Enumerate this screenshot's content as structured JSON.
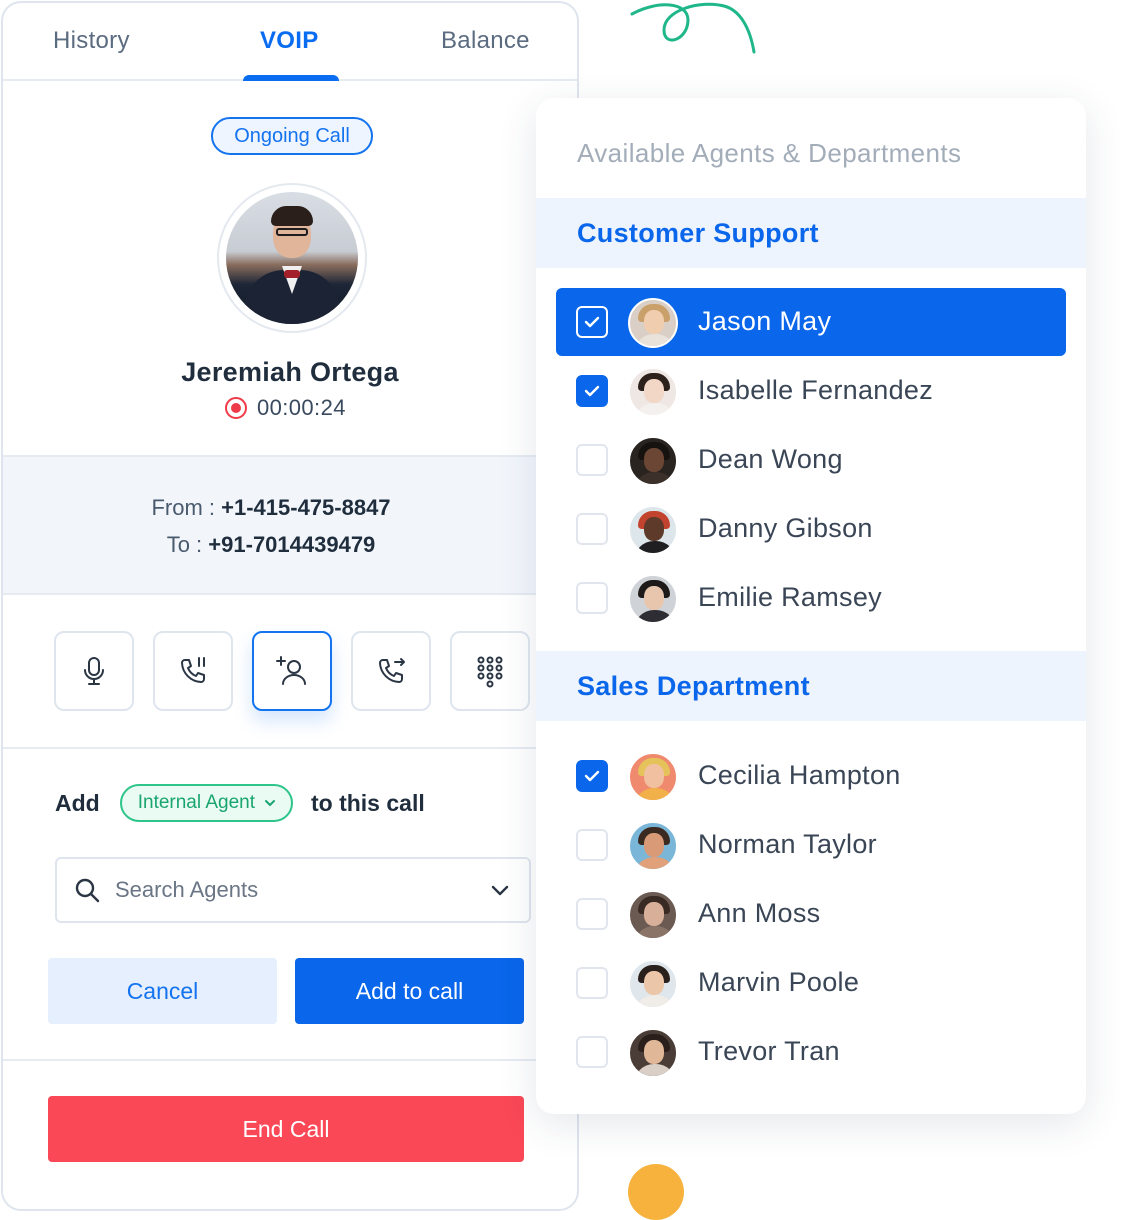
{
  "tabs": [
    {
      "label": "History"
    },
    {
      "label": "VOIP"
    },
    {
      "label": "Balance"
    }
  ],
  "call": {
    "status": "Ongoing Call",
    "caller_name": "Jeremiah Ortega",
    "duration": "00:00:24",
    "from_label": "From :",
    "from_number": "+1-415-475-8847",
    "to_label": "To :",
    "to_number": "+91-7014439479"
  },
  "controls": [
    {
      "icon": "microphone-icon"
    },
    {
      "icon": "call-hold-icon"
    },
    {
      "icon": "add-agent-icon",
      "active": true
    },
    {
      "icon": "call-forward-icon"
    },
    {
      "icon": "dialpad-icon"
    }
  ],
  "add_section": {
    "prefix": "Add",
    "agent_type": "Internal Agent",
    "suffix": "to this call",
    "search_placeholder": "Search Agents"
  },
  "buttons": {
    "cancel": "Cancel",
    "add_to_call": "Add to call",
    "end_call": "End Call"
  },
  "agents_panel": {
    "title": "Available Agents & Departments",
    "departments": [
      {
        "name": "Customer Support",
        "agents": [
          {
            "name": "Jason May",
            "checked": true,
            "highlighted": true
          },
          {
            "name": "Isabelle Fernandez",
            "checked": true
          },
          {
            "name": "Dean Wong",
            "checked": false
          },
          {
            "name": "Danny Gibson",
            "checked": false
          },
          {
            "name": "Emilie Ramsey",
            "checked": false
          }
        ]
      },
      {
        "name": "Sales Department",
        "agents": [
          {
            "name": "Cecilia Hampton",
            "checked": true
          },
          {
            "name": "Norman Taylor",
            "checked": false
          },
          {
            "name": "Ann Moss",
            "checked": false
          },
          {
            "name": "Marvin Poole",
            "checked": false
          },
          {
            "name": "Trevor Tran",
            "checked": false
          }
        ]
      }
    ]
  },
  "colors": {
    "primary": "#0a66ea",
    "danger": "#fa4856",
    "success": "#2ec58a"
  }
}
